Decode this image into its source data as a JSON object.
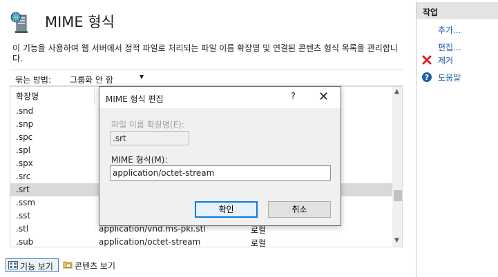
{
  "page": {
    "title": "MIME 형식",
    "description": "이 기능을 사용하여 웹 서버에서 정적 파일로 처리되는 파일 이름 확장명 및 연결된 콘텐츠 형식 목록을 관리합니다."
  },
  "groupby": {
    "label": "묶는 방법:",
    "value": "그룹화 안 함"
  },
  "list": {
    "header_ext": "확장명",
    "rows": [
      {
        "ext": ".snd",
        "mime": "",
        "type": ""
      },
      {
        "ext": ".snp",
        "mime": "",
        "type": ""
      },
      {
        "ext": ".spc",
        "mime": "",
        "type": ""
      },
      {
        "ext": ".spl",
        "mime": "",
        "type": ""
      },
      {
        "ext": ".spx",
        "mime": "",
        "type": ""
      },
      {
        "ext": ".src",
        "mime": "",
        "type": ""
      },
      {
        "ext": ".srt",
        "mime": "",
        "type": ""
      },
      {
        "ext": ".ssm",
        "mime": "",
        "type": ""
      },
      {
        "ext": ".sst",
        "mime": "",
        "type": ""
      },
      {
        "ext": ".stl",
        "mime": "application/vnd.ms-pki.stl",
        "type": "로컬"
      },
      {
        "ext": ".sub",
        "mime": "application/octet-stream",
        "type": "로컬"
      }
    ]
  },
  "views": {
    "features": "기능 보기",
    "content": "콘텐츠 보기"
  },
  "actions": {
    "title": "작업",
    "add": "추가...",
    "edit": "편집...",
    "remove": "제거",
    "help": "도움말"
  },
  "dialog": {
    "title": "MIME 형식 편집",
    "help": "?",
    "close": "✕",
    "ext_label": "파일 이름 확장명(E):",
    "ext_value": ".srt",
    "mime_label": "MIME 형식(M):",
    "mime_value": "application/octet-stream",
    "ok": "확인",
    "cancel": "취소"
  },
  "colors": {
    "accent": "#0f78d7",
    "remove_icon": "#d42020",
    "help_icon": "#1f5fa8",
    "link": "#1f5fa8"
  }
}
